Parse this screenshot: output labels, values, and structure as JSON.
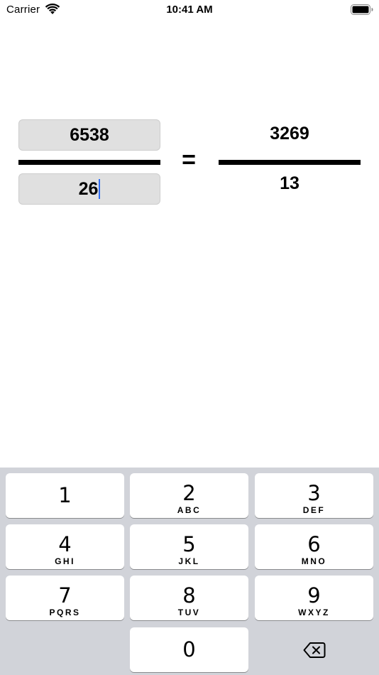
{
  "status_bar": {
    "carrier": "Carrier",
    "time": "10:41 AM",
    "wifi_icon": "wifi-icon",
    "battery_icon": "battery-icon"
  },
  "fraction": {
    "numerator_value": "6538",
    "denominator_value": "26",
    "equals_sign": "=",
    "result_numerator": "3269",
    "result_denominator": "13"
  },
  "keypad": {
    "keys": [
      {
        "digit": "1",
        "letters": ""
      },
      {
        "digit": "2",
        "letters": "ABC"
      },
      {
        "digit": "3",
        "letters": "DEF"
      },
      {
        "digit": "4",
        "letters": "GHI"
      },
      {
        "digit": "5",
        "letters": "JKL"
      },
      {
        "digit": "6",
        "letters": "MNO"
      },
      {
        "digit": "7",
        "letters": "PQRS"
      },
      {
        "digit": "8",
        "letters": "TUV"
      },
      {
        "digit": "9",
        "letters": "WXYZ"
      },
      {
        "digit": "0",
        "letters": ""
      }
    ],
    "delete_icon": "backspace-icon"
  },
  "colors": {
    "caret": "#2f6cf2",
    "keypad_background": "#d1d3d9",
    "field_background": "#e0e0e0"
  }
}
